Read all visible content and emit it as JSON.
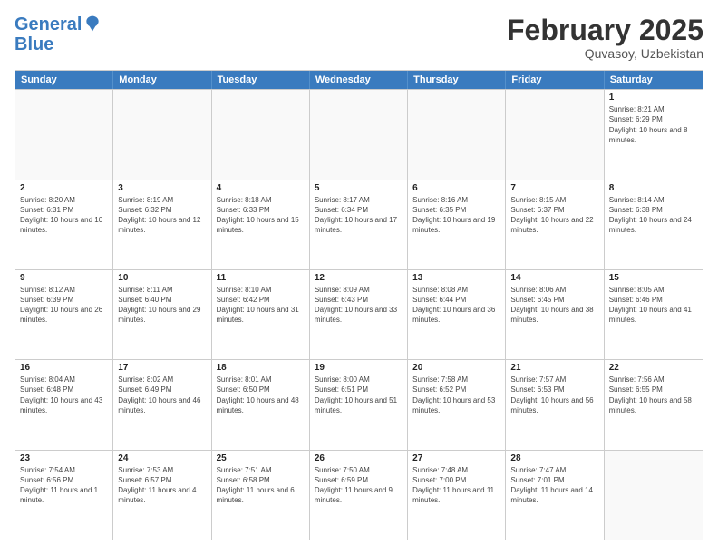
{
  "header": {
    "logo": {
      "line1": "General",
      "line2": "Blue"
    },
    "title": "February 2025",
    "subtitle": "Quvasoy, Uzbekistan"
  },
  "days_of_week": [
    "Sunday",
    "Monday",
    "Tuesday",
    "Wednesday",
    "Thursday",
    "Friday",
    "Saturday"
  ],
  "weeks": [
    [
      {
        "day": "",
        "info": ""
      },
      {
        "day": "",
        "info": ""
      },
      {
        "day": "",
        "info": ""
      },
      {
        "day": "",
        "info": ""
      },
      {
        "day": "",
        "info": ""
      },
      {
        "day": "",
        "info": ""
      },
      {
        "day": "1",
        "info": "Sunrise: 8:21 AM\nSunset: 6:29 PM\nDaylight: 10 hours and 8 minutes."
      }
    ],
    [
      {
        "day": "2",
        "info": "Sunrise: 8:20 AM\nSunset: 6:31 PM\nDaylight: 10 hours and 10 minutes."
      },
      {
        "day": "3",
        "info": "Sunrise: 8:19 AM\nSunset: 6:32 PM\nDaylight: 10 hours and 12 minutes."
      },
      {
        "day": "4",
        "info": "Sunrise: 8:18 AM\nSunset: 6:33 PM\nDaylight: 10 hours and 15 minutes."
      },
      {
        "day": "5",
        "info": "Sunrise: 8:17 AM\nSunset: 6:34 PM\nDaylight: 10 hours and 17 minutes."
      },
      {
        "day": "6",
        "info": "Sunrise: 8:16 AM\nSunset: 6:35 PM\nDaylight: 10 hours and 19 minutes."
      },
      {
        "day": "7",
        "info": "Sunrise: 8:15 AM\nSunset: 6:37 PM\nDaylight: 10 hours and 22 minutes."
      },
      {
        "day": "8",
        "info": "Sunrise: 8:14 AM\nSunset: 6:38 PM\nDaylight: 10 hours and 24 minutes."
      }
    ],
    [
      {
        "day": "9",
        "info": "Sunrise: 8:12 AM\nSunset: 6:39 PM\nDaylight: 10 hours and 26 minutes."
      },
      {
        "day": "10",
        "info": "Sunrise: 8:11 AM\nSunset: 6:40 PM\nDaylight: 10 hours and 29 minutes."
      },
      {
        "day": "11",
        "info": "Sunrise: 8:10 AM\nSunset: 6:42 PM\nDaylight: 10 hours and 31 minutes."
      },
      {
        "day": "12",
        "info": "Sunrise: 8:09 AM\nSunset: 6:43 PM\nDaylight: 10 hours and 33 minutes."
      },
      {
        "day": "13",
        "info": "Sunrise: 8:08 AM\nSunset: 6:44 PM\nDaylight: 10 hours and 36 minutes."
      },
      {
        "day": "14",
        "info": "Sunrise: 8:06 AM\nSunset: 6:45 PM\nDaylight: 10 hours and 38 minutes."
      },
      {
        "day": "15",
        "info": "Sunrise: 8:05 AM\nSunset: 6:46 PM\nDaylight: 10 hours and 41 minutes."
      }
    ],
    [
      {
        "day": "16",
        "info": "Sunrise: 8:04 AM\nSunset: 6:48 PM\nDaylight: 10 hours and 43 minutes."
      },
      {
        "day": "17",
        "info": "Sunrise: 8:02 AM\nSunset: 6:49 PM\nDaylight: 10 hours and 46 minutes."
      },
      {
        "day": "18",
        "info": "Sunrise: 8:01 AM\nSunset: 6:50 PM\nDaylight: 10 hours and 48 minutes."
      },
      {
        "day": "19",
        "info": "Sunrise: 8:00 AM\nSunset: 6:51 PM\nDaylight: 10 hours and 51 minutes."
      },
      {
        "day": "20",
        "info": "Sunrise: 7:58 AM\nSunset: 6:52 PM\nDaylight: 10 hours and 53 minutes."
      },
      {
        "day": "21",
        "info": "Sunrise: 7:57 AM\nSunset: 6:53 PM\nDaylight: 10 hours and 56 minutes."
      },
      {
        "day": "22",
        "info": "Sunrise: 7:56 AM\nSunset: 6:55 PM\nDaylight: 10 hours and 58 minutes."
      }
    ],
    [
      {
        "day": "23",
        "info": "Sunrise: 7:54 AM\nSunset: 6:56 PM\nDaylight: 11 hours and 1 minute."
      },
      {
        "day": "24",
        "info": "Sunrise: 7:53 AM\nSunset: 6:57 PM\nDaylight: 11 hours and 4 minutes."
      },
      {
        "day": "25",
        "info": "Sunrise: 7:51 AM\nSunset: 6:58 PM\nDaylight: 11 hours and 6 minutes."
      },
      {
        "day": "26",
        "info": "Sunrise: 7:50 AM\nSunset: 6:59 PM\nDaylight: 11 hours and 9 minutes."
      },
      {
        "day": "27",
        "info": "Sunrise: 7:48 AM\nSunset: 7:00 PM\nDaylight: 11 hours and 11 minutes."
      },
      {
        "day": "28",
        "info": "Sunrise: 7:47 AM\nSunset: 7:01 PM\nDaylight: 11 hours and 14 minutes."
      },
      {
        "day": "",
        "info": ""
      }
    ]
  ]
}
